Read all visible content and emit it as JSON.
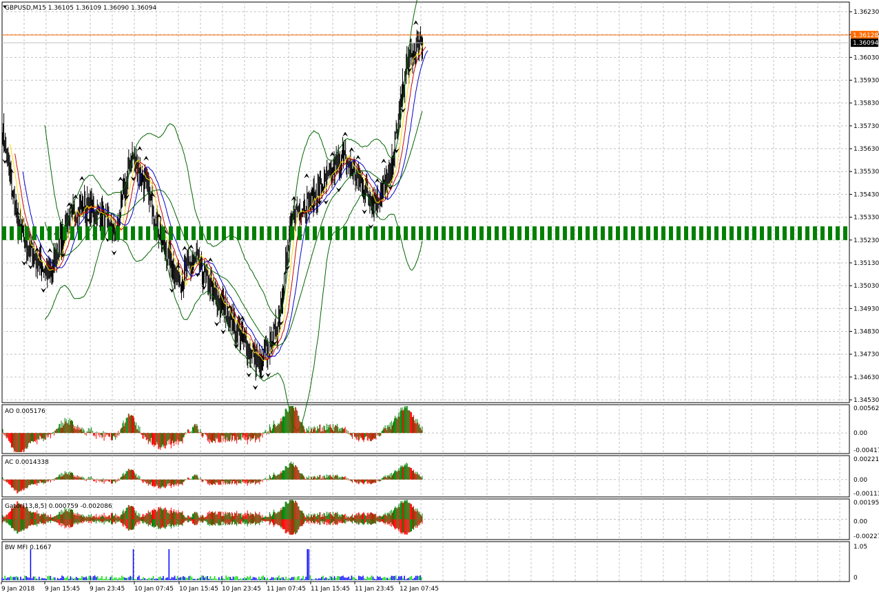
{
  "window": {
    "symbol_line": "GBPUSD,M15  1.36105 1.36109 1.36090 1.36094"
  },
  "colors": {
    "background": "#ffffff",
    "grid": "#c0c0c0",
    "candles": "#000000",
    "ma_fast": "#ffd700",
    "ma_mid": "#cc0000",
    "ma_slow": "#0000cc",
    "bands": "#006400",
    "bullish": "#008000",
    "bearish": "#ff0000",
    "volume_blue": "#0000ff",
    "volume_green": "#00dd00",
    "ask_line": "#ff6a00",
    "bid_line": "#c0c0c0"
  },
  "price_axis": {
    "ticks": [
      "1.36230",
      "1.36130",
      "1.36030",
      "1.35930",
      "1.35830",
      "1.35730",
      "1.35630",
      "1.35530",
      "1.35430",
      "1.35330",
      "1.35230",
      "1.35130",
      "1.35030",
      "1.34930",
      "1.34830",
      "1.34730",
      "1.34630",
      "1.34530"
    ],
    "ask_label": "1.36128",
    "bid_label": "1.36094"
  },
  "time_axis": {
    "labels": [
      "9 Jan 2018",
      "9 Jan 15:45",
      "9 Jan 23:45",
      "10 Jan 07:45",
      "10 Jan 15:45",
      "10 Jan 23:45",
      "11 Jan 07:45",
      "11 Jan 15:45",
      "11 Jan 23:45",
      "12 Jan 07:45"
    ]
  },
  "subpanels": [
    {
      "title": "AO 0.005176",
      "ticks": [
        "0.005621",
        "0.00",
        "-0.004177"
      ]
    },
    {
      "title": "AC 0.0014338",
      "ticks": [
        "0.002218",
        "0.00",
        "-0.001136"
      ]
    },
    {
      "title": "Gator(13,8,5) 0.000759 -0.002086",
      "ticks": [
        "0.001953",
        "0.00",
        "-0.002278"
      ]
    },
    {
      "title": "BW MFI 0.1667",
      "ticks": [
        "1.05",
        "0"
      ]
    }
  ],
  "chart_data": [
    {
      "type": "candlestick",
      "symbol": "GBPUSD",
      "timeframe": "M15",
      "ohlc_current": {
        "open": 1.36105,
        "high": 1.36109,
        "low": 1.3609,
        "close": 1.36094
      },
      "ylim": [
        1.3453,
        1.3623
      ],
      "x": [
        "9 Jan 2018",
        "9 Jan 15:45",
        "9 Jan 23:45",
        "10 Jan 07:45",
        "10 Jan 15:45",
        "10 Jan 23:45",
        "11 Jan 07:45",
        "11 Jan 15:45",
        "11 Jan 23:45",
        "12 Jan 07:45"
      ],
      "price_path": [
        1.3572,
        1.3528,
        1.3515,
        1.3508,
        1.3532,
        1.3538,
        1.3535,
        1.3525,
        1.356,
        1.3545,
        1.352,
        1.3505,
        1.3515,
        1.35,
        1.349,
        1.3478,
        1.3468,
        1.3485,
        1.3535,
        1.354,
        1.3548,
        1.356,
        1.355,
        1.354,
        1.355,
        1.36,
        1.361
      ],
      "ask": 1.36128,
      "bid": 1.36094,
      "grid": true
    },
    {
      "type": "bar",
      "name": "AO",
      "value": 0.005176,
      "ylim": [
        -0.004177,
        0.005621
      ]
    },
    {
      "type": "bar",
      "name": "AC",
      "value": 0.0014338,
      "ylim": [
        -0.001136,
        0.002218
      ]
    },
    {
      "type": "bar",
      "name": "Gator(13,8,5)",
      "values": [
        0.000759,
        -0.002086
      ],
      "ylim": [
        -0.002278,
        0.001953
      ]
    },
    {
      "type": "bar",
      "name": "BW MFI",
      "value": 0.1667,
      "ylim": [
        0,
        1.05
      ]
    }
  ]
}
